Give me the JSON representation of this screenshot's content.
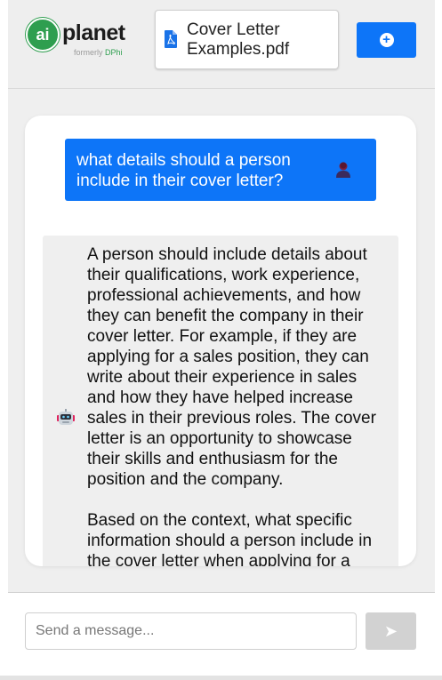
{
  "brand": {
    "logo_mark": "ai",
    "name": "planet",
    "tagline_prefix": "formerly",
    "tagline_brand": "DPhi",
    "accent": "#2e9e4f"
  },
  "document": {
    "icon": "pdf-file-icon",
    "file_name": "Cover Letter Examples.pdf"
  },
  "toolbar": {
    "add_icon": "plus-circle-icon",
    "accent": "#0d75f8"
  },
  "chat": {
    "messages": [
      {
        "role": "user",
        "avatar_icon": "user-avatar-icon",
        "text": "what details should a person include in their cover letter?"
      },
      {
        "role": "assistant",
        "avatar_icon": "robot-avatar-icon",
        "text": "A person should include details about their qualifications, work experience, professional achievements, and how they can benefit the company in their cover letter. For example, if they are applying for a sales position, they can write about their experience in sales and how they have helped increase sales in their previous roles. The cover letter is an opportunity to showcase their skills and enthusiasm for the position and the company.\n\nBased on the context, what specific information should a person include in the cover letter when applying for a"
      }
    ]
  },
  "composer": {
    "placeholder": "Send a message...",
    "value": "",
    "send_icon": "send-arrow-icon"
  }
}
